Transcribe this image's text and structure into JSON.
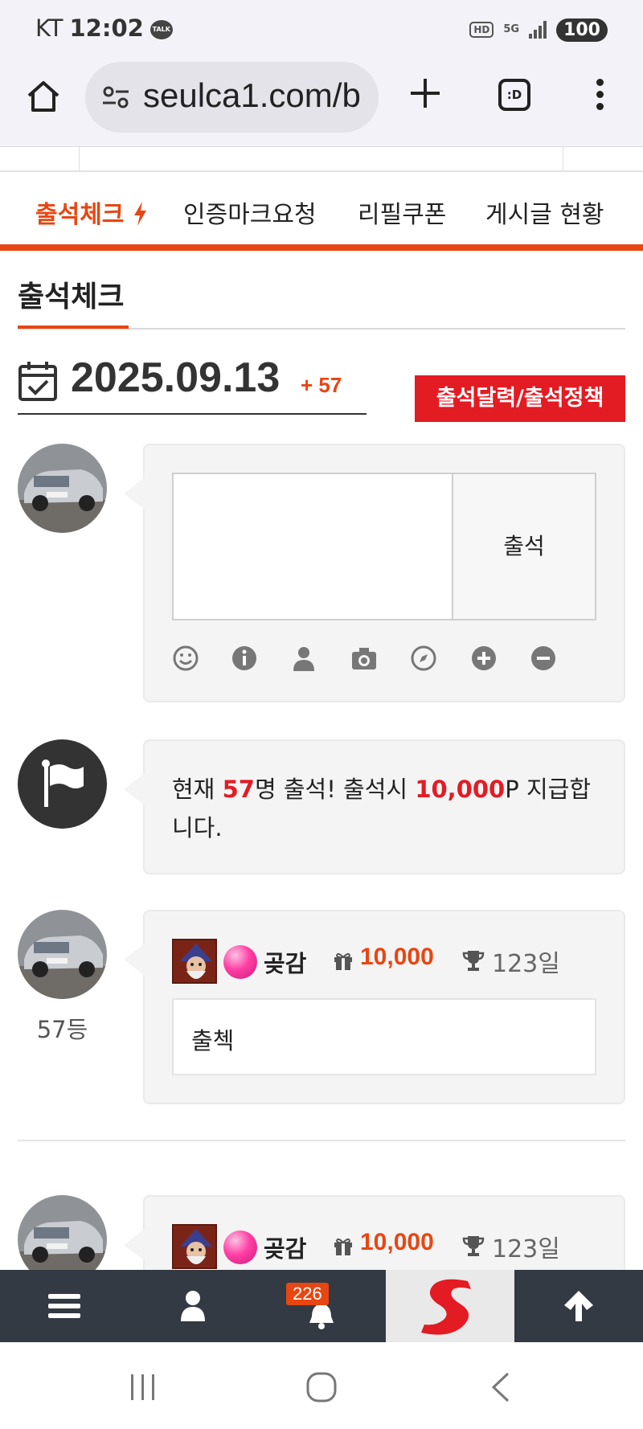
{
  "status_bar": {
    "carrier": "KT",
    "time": "12:02",
    "talk_label": "TALK",
    "hd_label": "HD",
    "network": "5G",
    "battery": "100"
  },
  "browser": {
    "url": "seulca1.com/b",
    "tabs_label": ":D"
  },
  "nav_tabs": [
    {
      "label": "출석체크",
      "active": true
    },
    {
      "label": "인증마크요청",
      "active": false
    },
    {
      "label": "리필쿠폰",
      "active": false
    },
    {
      "label": "게시글 현황",
      "active": false
    }
  ],
  "section": {
    "title": "출석체크"
  },
  "date_bar": {
    "date": "2025.09.13",
    "count": "+ 57",
    "calendar_button": "출석달력/출석정책"
  },
  "compose": {
    "submit_label": "출석",
    "textarea_value": "",
    "tools": [
      "smiley-icon",
      "info-icon",
      "user-icon",
      "camera-icon",
      "compass-icon",
      "plus-circle-icon",
      "minus-circle-icon"
    ]
  },
  "notice": {
    "prefix": "현재 ",
    "count": "57",
    "middle": "명 출석! 출석시 ",
    "points": "10,000",
    "suffix": "P 지급합니다."
  },
  "posts": [
    {
      "rank": "57등",
      "nickname": "곶감",
      "points": "10,000",
      "days": "123일",
      "content": "출첵"
    },
    {
      "nickname": "곶감",
      "points": "10,000",
      "days": "123일"
    }
  ],
  "bottom_nav": {
    "notification_count": "226"
  },
  "colors": {
    "accent": "#e84612",
    "red": "#e31b23",
    "bottom_bar": "#343a44"
  }
}
